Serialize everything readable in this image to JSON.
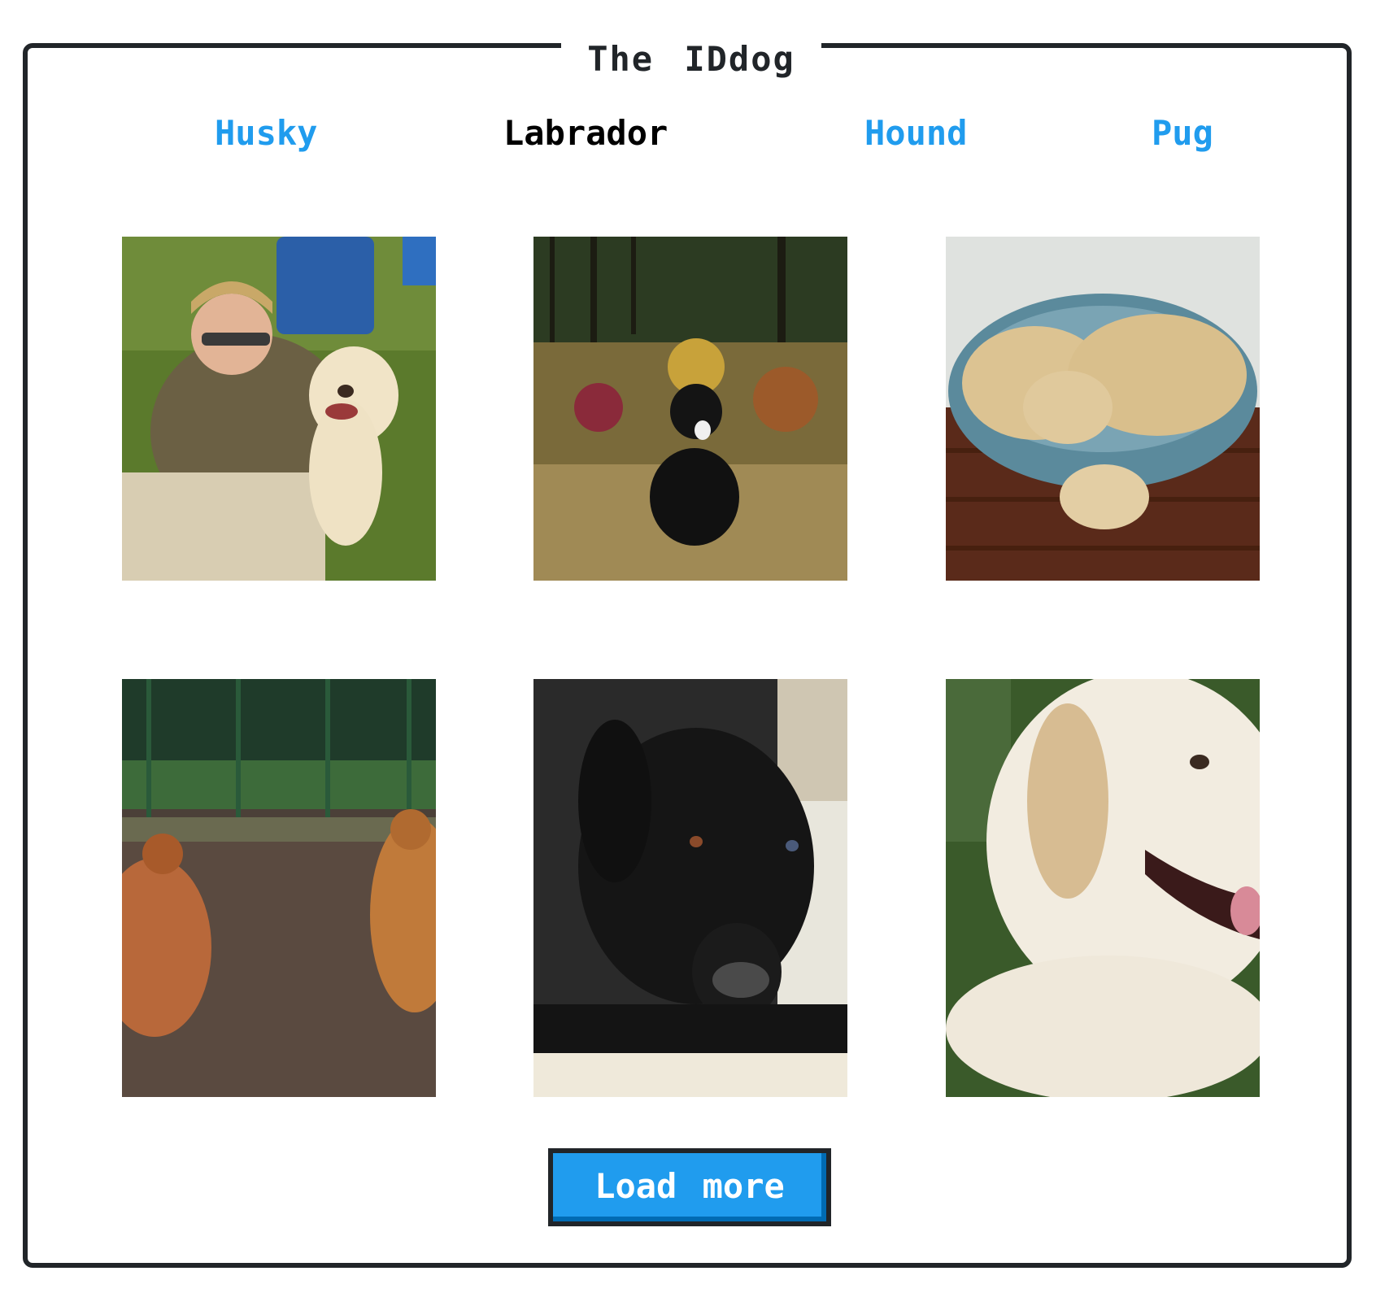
{
  "site": {
    "title": "The IDdog"
  },
  "nav": {
    "items": [
      {
        "label": "Husky",
        "active": false
      },
      {
        "label": "Labrador",
        "active": true
      },
      {
        "label": "Hound",
        "active": false
      },
      {
        "label": "Pug",
        "active": false
      }
    ]
  },
  "gallery": {
    "images": [
      {
        "subject": "man with yellow labrador on grass"
      },
      {
        "subject": "black labrador sitting in forest"
      },
      {
        "subject": "two yellow labradors sleeping in bed"
      },
      {
        "subject": "chickens in a fenced yard"
      },
      {
        "subject": "black labrador lying down close-up"
      },
      {
        "subject": "yellow labrador lying in grass close-up"
      }
    ]
  },
  "actions": {
    "load_more_label": "Load more"
  },
  "colors": {
    "accent": "#209cee",
    "accent_shadow": "#006bb3",
    "frame": "#212529",
    "active_link": "#000000"
  }
}
